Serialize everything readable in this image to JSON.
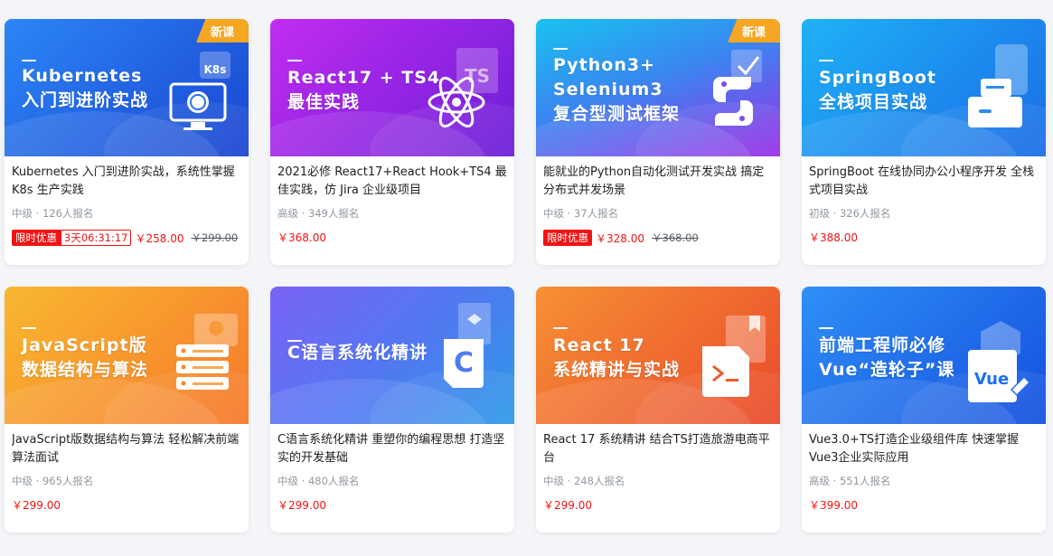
{
  "courses": [
    {
      "banner_title": "Kubernetes\n入门到进阶实战",
      "badge": "新课",
      "icon": "kubernetes-monitor-icon",
      "description": "Kubernetes 入门到进阶实战，系统性掌握 K8s 生产实践",
      "meta": "中级 · 126人报名",
      "promo_label": "限时优惠",
      "countdown": "3天06:31:17",
      "price": "￥258.00",
      "old_price": "￥299.00",
      "gradient": [
        "#1f7bf0",
        "#1a4fd6"
      ]
    },
    {
      "banner_title": "React17 + TS4\n最佳实践",
      "badge": "",
      "icon": "react-icon",
      "description": "2021必修 React17+React Hook+TS4 最佳实践，仿 Jira 企业级项目",
      "meta": "高级 · 349人报名",
      "price": "￥368.00",
      "gradient": [
        "#b524f0",
        "#6b1fd8"
      ]
    },
    {
      "banner_title": "Python3+\nSelenium3\n复合型测试框架",
      "badge": "新课",
      "icon": "python-icon",
      "description": "能就业的Python自动化测试开发实战 搞定分布式并发场景",
      "meta": "中级 · 37人报名",
      "promo_label": "限时优惠",
      "price": "￥328.00",
      "old_price": "￥368.00",
      "gradient": [
        "#20b8f0",
        "#8a2ee8"
      ]
    },
    {
      "banner_title": "SpringBoot\n全栈项目实战",
      "badge": "",
      "icon": "folder-phone-icon",
      "description": "SpringBoot 在线协同办公小程序开发 全栈式项目实战",
      "meta": "初级 · 326人报名",
      "price": "￥388.00",
      "gradient": [
        "#1da7f5",
        "#1b6ee8"
      ]
    },
    {
      "banner_title": "JavaScript版\n数据结构与算法",
      "badge": "",
      "icon": "server-stack-icon",
      "description": "JavaScript版数据结构与算法 轻松解决前端算法面试",
      "meta": "中级 · 965人报名",
      "price": "￥299.00",
      "gradient": [
        "#f7b32b",
        "#f57c2a"
      ]
    },
    {
      "banner_title": "C语言系统化精讲",
      "badge": "",
      "icon": "c-language-icon",
      "description": "C语言系统化精讲 重塑你的编程思想 打造坚实的开发基础",
      "meta": "中级 · 480人报名",
      "price": "￥299.00",
      "gradient": [
        "#6a6cf5",
        "#3d8af0"
      ]
    },
    {
      "banner_title": "React 17\n系统精讲与实战",
      "badge": "",
      "icon": "terminal-file-icon",
      "description": "React 17 系统精讲 结合TS打造旅游电商平台",
      "meta": "中级 · 248人报名",
      "price": "￥299.00",
      "gradient": [
        "#f5863a",
        "#e8402e"
      ]
    },
    {
      "banner_title": "前端工程师必修\nVue“造轮子”课",
      "badge": "",
      "icon": "vue-icon",
      "description": "Vue3.0+TS打造企业级组件库 快速掌握Vue3企业实际应用",
      "meta": "高级 · 551人报名",
      "price": "￥399.00",
      "gradient": [
        "#2a8af5",
        "#1555e0"
      ]
    }
  ]
}
